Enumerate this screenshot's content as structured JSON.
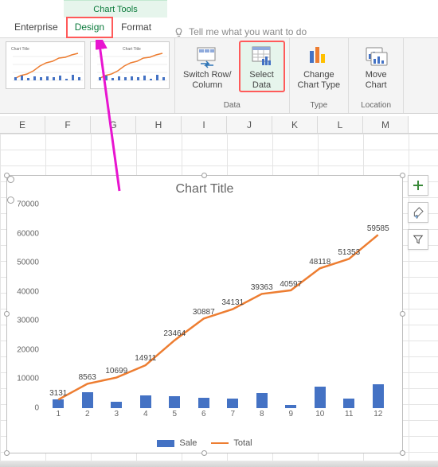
{
  "contextual_tab_group": "Chart Tools",
  "tabs": {
    "enterprise": "Enterprise",
    "design": "Design",
    "format": "Format",
    "tellme_placeholder": "Tell me what you want to do"
  },
  "ribbon": {
    "switch_rc": "Switch Row/\nColumn",
    "select_data": "Select\nData",
    "change_ct": "Change\nChart Type",
    "move_chart": "Move\nChart",
    "group_data": "Data",
    "group_type": "Type",
    "group_location": "Location"
  },
  "columns": [
    "E",
    "F",
    "G",
    "H",
    "I",
    "J",
    "K",
    "L",
    "M"
  ],
  "chart_side_buttons": {
    "add": "+",
    "brush": "brush",
    "filter": "filter"
  },
  "chart_data": {
    "type": "combo",
    "title": "Chart Title",
    "categories": [
      1,
      2,
      3,
      4,
      5,
      6,
      7,
      8,
      9,
      10,
      11,
      12
    ],
    "ylim": [
      0,
      70000
    ],
    "yticks": [
      0,
      10000,
      20000,
      30000,
      40000,
      50000,
      60000,
      70000
    ],
    "series": [
      {
        "name": "Sale",
        "type": "bar",
        "color": "#4472c4",
        "values": [
          3131,
          5432,
          2136,
          4348,
          4212,
          3519,
          3244,
          5232,
          1234,
          7521,
          3235,
          8232
        ]
      },
      {
        "name": "Total",
        "type": "line",
        "color": "#ed7d31",
        "values": [
          3131,
          8563,
          10699,
          14911,
          23464,
          30887,
          34131,
          39363,
          40597,
          48118,
          51353,
          59585
        ],
        "data_labels": [
          3131,
          8563,
          10699,
          14911,
          23464,
          30887,
          34131,
          39363,
          40597,
          48118,
          51353,
          59585
        ]
      }
    ]
  }
}
